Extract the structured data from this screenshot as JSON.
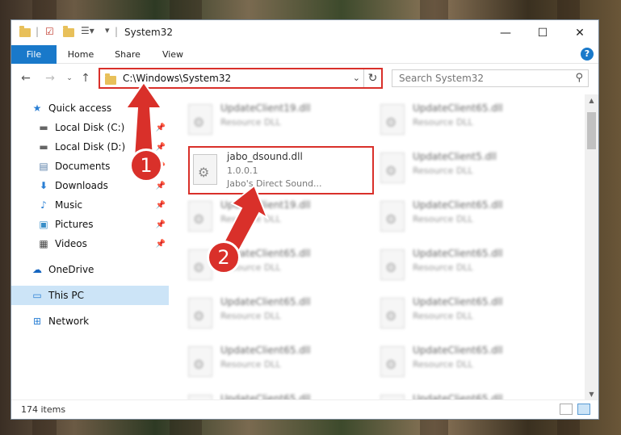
{
  "window": {
    "title": "System32",
    "minimize": "—",
    "maximize": "☐",
    "close": "✕"
  },
  "ribbon": {
    "tabs": [
      "File",
      "Home",
      "Share",
      "View"
    ],
    "help": "?"
  },
  "address": {
    "path": "C:\\Windows\\System32",
    "search_placeholder": "Search System32"
  },
  "sidebar": {
    "items": [
      {
        "label": "Quick access",
        "icon": "star-icon",
        "pinned": false
      },
      {
        "label": "Local Disk (C:)",
        "icon": "drive-icon",
        "pinned": true
      },
      {
        "label": "Local Disk (D:)",
        "icon": "drive-icon",
        "pinned": true
      },
      {
        "label": "Documents",
        "icon": "documents-icon",
        "pinned": true
      },
      {
        "label": "Downloads",
        "icon": "download-arrow-icon",
        "pinned": true
      },
      {
        "label": "Music",
        "icon": "music-note-icon",
        "pinned": true
      },
      {
        "label": "Pictures",
        "icon": "pictures-icon",
        "pinned": true
      },
      {
        "label": "Videos",
        "icon": "film-icon",
        "pinned": true
      },
      {
        "label": "OneDrive",
        "icon": "cloud-icon",
        "pinned": false
      },
      {
        "label": "This PC",
        "icon": "monitor-icon",
        "pinned": false,
        "selected": true
      },
      {
        "label": "Network",
        "icon": "network-icon",
        "pinned": false
      }
    ]
  },
  "files": {
    "highlighted": {
      "name": "jabo_dsound.dll",
      "version": "1.0.0.1",
      "description": "Jabo's Direct Sound..."
    },
    "left_column": [
      {
        "name": "UpdateClient19.dll",
        "type": "Resource DLL"
      },
      {
        "name": "UpdateClient19.dll",
        "type": "Resource DLL"
      },
      {
        "name": "UpdateClient65.dll",
        "type": "Resource DLL"
      },
      {
        "name": "UpdateClient65.dll",
        "type": "Resource DLL"
      },
      {
        "name": "UpdateClient65.dll",
        "type": "Resource DLL"
      },
      {
        "name": "UpdateClient65.dll",
        "type": "Resource DLL"
      }
    ],
    "right_column": [
      {
        "name": "UpdateClient65.dll",
        "type": "Resource DLL"
      },
      {
        "name": "UpdateClient5.dll",
        "type": "Resource DLL"
      },
      {
        "name": "UpdateClient65.dll",
        "type": "Resource DLL"
      },
      {
        "name": "UpdateClient65.dll",
        "type": "Resource DLL"
      },
      {
        "name": "UpdateClient65.dll",
        "type": "Resource DLL"
      },
      {
        "name": "UpdateClient65.dll",
        "type": "Resource DLL"
      },
      {
        "name": "UpdateClient65.dll",
        "type": "Resource DLL"
      }
    ]
  },
  "status": {
    "item_count": "174 items"
  },
  "annotations": {
    "step1": "1",
    "step2": "2"
  },
  "colors": {
    "accent": "#1979ca",
    "highlight_red": "#d9302a",
    "selected_bg": "#cce4f7"
  }
}
